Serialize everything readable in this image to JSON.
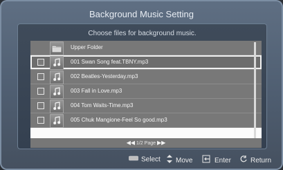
{
  "window": {
    "title": "Background Music Setting"
  },
  "panel": {
    "subtitle": "Choose files for background music."
  },
  "list": {
    "items": [
      {
        "type": "folder",
        "label": "Upper Folder",
        "checkbox": false
      },
      {
        "type": "music",
        "label": "001 Swan Song feat.TBNY.mp3",
        "checkbox": true,
        "selected": true
      },
      {
        "type": "music",
        "label": "002 Beatles-Yesterday.mp3",
        "checkbox": true
      },
      {
        "type": "music",
        "label": "003 Fall in Love.mp3",
        "checkbox": true
      },
      {
        "type": "music",
        "label": "004 Tom Waits-Time.mp3",
        "checkbox": true
      },
      {
        "type": "music",
        "label": "005 Chuk Mangione-Feel So good.mp3",
        "checkbox": true
      }
    ],
    "pagination": {
      "left_arrow": "◀◀",
      "text": "1/2 Page",
      "right_arrow": "▶▶"
    }
  },
  "footer": {
    "select_label": "Select",
    "move_label": "Move",
    "enter_label": "Enter",
    "return_label": "Return"
  },
  "icons": {
    "folder": "folder-icon",
    "music": "music-note-icon",
    "select": "grey-button-icon",
    "move": "up-down-arrows-icon",
    "enter": "enter-icon",
    "return": "return-icon"
  }
}
